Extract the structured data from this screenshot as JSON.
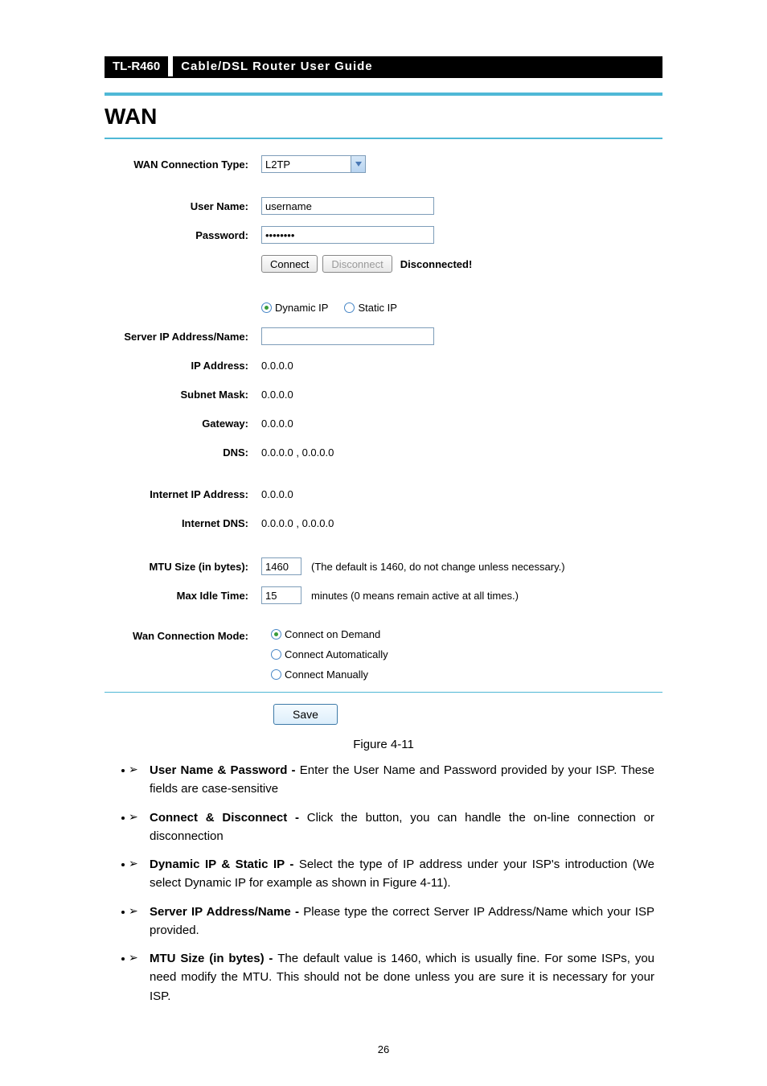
{
  "header": {
    "model": "TL-R460",
    "title": "Cable/DSL  Router  User  Guide"
  },
  "panel": {
    "title": "WAN",
    "labels": {
      "connType": "WAN Connection Type:",
      "userName": "User Name:",
      "password": "Password:",
      "serverIpName": "Server IP Address/Name:",
      "ipAddress": "IP Address:",
      "subnet": "Subnet Mask:",
      "gateway": "Gateway:",
      "dns": "DNS:",
      "internetIp": "Internet IP Address:",
      "internetDns": "Internet DNS:",
      "mtu": "MTU Size (in bytes):",
      "maxIdle": "Max Idle Time:",
      "connMode": "Wan Connection Mode:"
    },
    "values": {
      "connType": "L2TP",
      "userName": "username",
      "password": "••••••••",
      "connectBtn": "Connect",
      "disconnectBtn": "Disconnect",
      "status": "Disconnected!",
      "dynamicIpLabel": "Dynamic IP",
      "staticIpLabel": "Static IP",
      "serverIpName": "",
      "ipAddress": "0.0.0.0",
      "subnet": "0.0.0.0",
      "gateway": "0.0.0.0",
      "dns": "0.0.0.0 , 0.0.0.0",
      "internetIp": "0.0.0.0",
      "internetDns": "0.0.0.0 , 0.0.0.0",
      "mtu": "1460",
      "mtuHint": "(The default is 1460, do not change unless necessary.)",
      "maxIdle": "15",
      "maxIdleHint": "minutes (0 means remain active at all times.)",
      "mode1": "Connect on Demand",
      "mode2": "Connect Automatically",
      "mode3": "Connect Manually",
      "saveBtn": "Save"
    },
    "ipTypeSelected": "dynamic",
    "modeSelected": "demand"
  },
  "figureCaption": "Figure 4-11",
  "bullets": [
    {
      "bold": "User Name & Password - ",
      "text": "Enter the User Name and Password provided by your ISP. These fields are case-sensitive"
    },
    {
      "bold": "Connect & Disconnect - ",
      "text": "Click the button, you can handle the on-line connection or disconnection"
    },
    {
      "bold": "Dynamic IP & Static IP - ",
      "text": "Select the type of IP address under your ISP's introduction (We select Dynamic IP for example as shown in Figure 4-11)."
    },
    {
      "bold": "Server IP Address/Name - ",
      "text": "Please type the correct Server IP Address/Name which your ISP provided."
    },
    {
      "bold": "MTU Size (in bytes) - ",
      "text": "The default value is 1460, which is usually fine. For some ISPs, you need modify the MTU. This should not be done unless you are sure it is necessary for your ISP."
    }
  ],
  "pageNumber": "26"
}
